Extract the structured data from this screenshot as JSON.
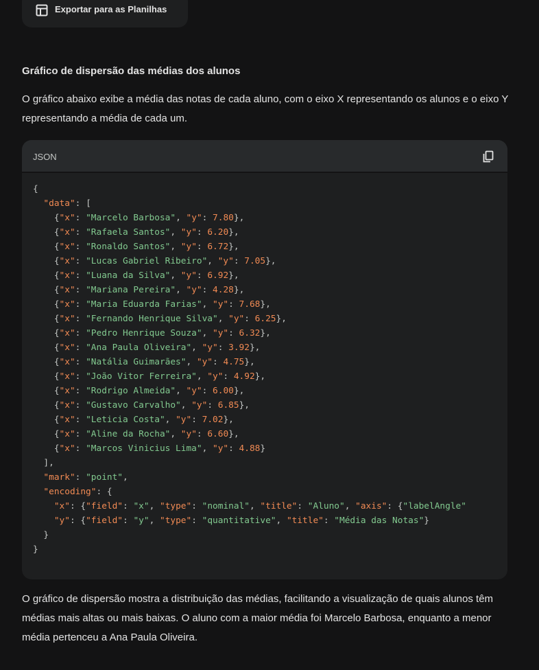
{
  "export_button": {
    "label": "Exportar para as Planilhas",
    "icon": "table-grid-icon"
  },
  "heading": "Gráfico de dispersão das médias dos alunos",
  "intro_paragraph": "O gráfico abaixo exibe a média das notas de cada aluno, com o eixo X representando os alunos e o eixo Y representando a média de cada um.",
  "code_block": {
    "language": "JSON",
    "copy_icon": "copy-icon",
    "data_points": [
      {
        "x": "Marcelo Barbosa",
        "y": "7.80"
      },
      {
        "x": "Rafaela Santos",
        "y": "6.20"
      },
      {
        "x": "Ronaldo Santos",
        "y": "6.72"
      },
      {
        "x": "Lucas Gabriel Ribeiro",
        "y": "7.05"
      },
      {
        "x": "Luana da Silva",
        "y": "6.92"
      },
      {
        "x": "Mariana Pereira",
        "y": "4.28"
      },
      {
        "x": "Maria Eduarda Farias",
        "y": "7.68"
      },
      {
        "x": "Fernando Henrique Silva",
        "y": "6.25"
      },
      {
        "x": "Pedro Henrique Souza",
        "y": "6.32"
      },
      {
        "x": "Ana Paula Oliveira",
        "y": "3.92"
      },
      {
        "x": "Natália Guimarães",
        "y": "4.75"
      },
      {
        "x": "João Vitor Ferreira",
        "y": "4.92"
      },
      {
        "x": "Rodrigo Almeida",
        "y": "6.00"
      },
      {
        "x": "Gustavo Carvalho",
        "y": "6.85"
      },
      {
        "x": "Leticia Costa",
        "y": "7.02"
      },
      {
        "x": "Aline da Rocha",
        "y": "6.60"
      },
      {
        "x": "Marcos Vinicius Lima",
        "y": "4.88"
      }
    ],
    "mark": "point",
    "encoding": {
      "x": {
        "field": "x",
        "type": "nominal",
        "title": "Aluno",
        "axis_key": "labelAngle"
      },
      "y": {
        "field": "y",
        "type": "quantitative",
        "title": "Média das Notas"
      }
    }
  },
  "closing_paragraph": "O gráfico de dispersão mostra a distribuição das médias, facilitando a visualização de quais alunos têm médias mais altas ou mais baixas. O aluno com a maior média foi Marcelo Barbosa, enquanto a menor média pertenceu a Ana Paula Oliveira.",
  "colors": {
    "background": "#131314",
    "card": "#1e1f20",
    "code_key": "#f28b54",
    "code_string": "#82c98f",
    "code_number": "#f28b54"
  }
}
